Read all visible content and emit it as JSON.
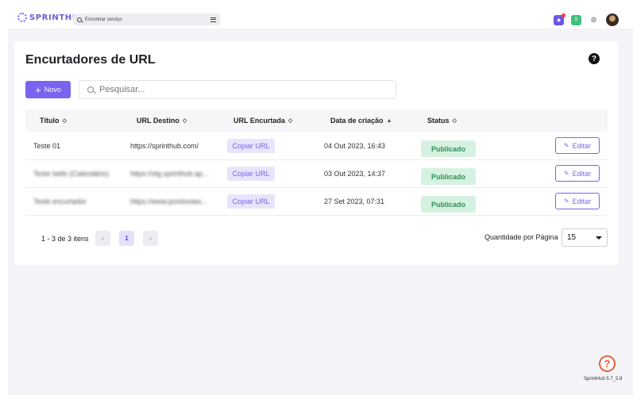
{
  "topbar": {
    "logo_text": "SPRINTHUB",
    "search_placeholder": "Encontrar serviço",
    "icons": [
      "notifications-icon",
      "apps-icon",
      "settings-icon",
      "avatar"
    ],
    "green_badge": "S"
  },
  "page": {
    "title": "Encurtadores de URL",
    "help": "?"
  },
  "toolbar": {
    "new_label": "Novo",
    "search_placeholder": "Pesquisar..."
  },
  "table": {
    "columns": [
      "Título",
      "URL Destino",
      "URL Encurtada",
      "Data de criação",
      "Status"
    ],
    "sort_icons": [
      "⌃⌄",
      "⌃⌄",
      "⌃⌄",
      "⌃",
      "⌃⌄"
    ],
    "rows": [
      {
        "title": "Teste 01",
        "url": "https://sprinthub.com/",
        "copy": "Copiar URL",
        "date": "04 Out 2023, 16:43",
        "status": "Publicado",
        "edit": "Editar"
      },
      {
        "title": "Teste bello (Calendário)",
        "url": "https://stg.sprinthub.ap...",
        "copy": "Copiar URL",
        "date": "03 Out 2023, 14:37",
        "status": "Publicado",
        "edit": "Editar"
      },
      {
        "title": "Teste encurtador",
        "url": "https://www.pontoviaw...",
        "copy": "Copiar URL",
        "date": "27 Set 2023, 07:31",
        "status": "Publicado",
        "edit": "Editar"
      }
    ]
  },
  "pagination": {
    "summary": "1 - 3 de 3 itens",
    "prev": "‹",
    "current": "1",
    "next": "›",
    "per_page_label": "Quantidade por Página",
    "per_page_value": "15"
  },
  "footer": {
    "support": "?",
    "version": "SprintHub 5.7_5.8"
  },
  "colors": {
    "accent": "#7a63f0",
    "status_bg": "#d5f2e0",
    "status_text": "#2f8f58",
    "support": "#e8603c"
  }
}
